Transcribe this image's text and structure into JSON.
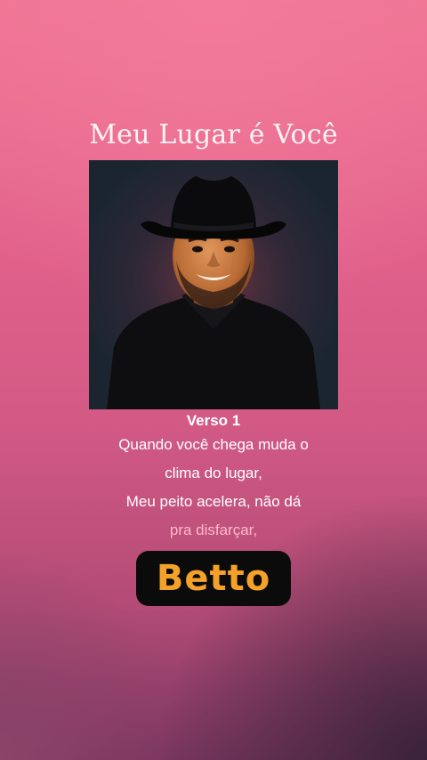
{
  "song": {
    "title": "Meu Lugar é Você"
  },
  "cover": {
    "image_alt": "portrait-of-singer-in-black-cowboy-hat"
  },
  "lyrics": {
    "section": "Verso 1",
    "lines": [
      "Quando você chega muda o",
      "clima do lugar,",
      "Meu peito acelera, não dá",
      "pra disfarçar,"
    ]
  },
  "brand": {
    "logo_text": "Betto",
    "logo_color": "#f4a12a"
  },
  "colors": {
    "background_top": "#f07494",
    "background_bottom": "#7a3660"
  }
}
